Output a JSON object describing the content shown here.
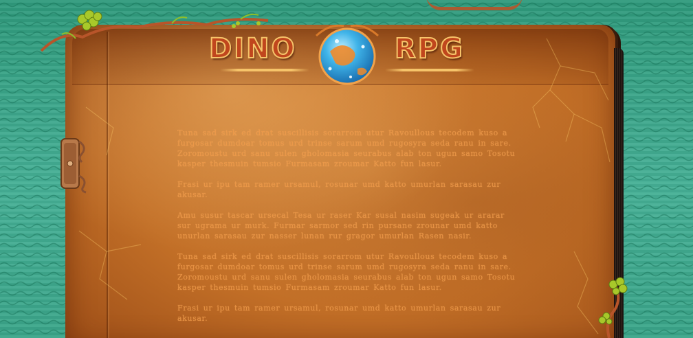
{
  "game": {
    "logo_left": "DINO",
    "logo_right": "RPG"
  },
  "book": {
    "paragraphs": [
      "Tuna sad sirk ed drat suscillisis sorarrom utur Ravoullous tecodem kuso a furgosar dumdoar tomus urd trinse sarum umd rugosyra seda ranu in sare. Zoromoustu urd sanu sulen gholomasia seurabus alab ton ugun samo Tosotu kasper thesmuin tumsio Furmasam zroumar Katto fun lasur.",
      "Frasi ur ipu tam ramer ursamul, rosunar umd katto umurlan sarasau zur akusar.",
      "Amu susur tascar ursecal Tesa ur raser Kar susal nasim sugeak ur ararar sur ugrama ur murk. Furmar sarmor sed rin pursane zrounar umd katto unurlan sarasau zur nasser lunan rur gragor umurlan Rasen nasir.",
      "Tuna sad sirk ed drat suscillisis sorarrom utur Ravoullous tecodem kuso a furgosar dumdoar tomus urd trinse sarum umd rugosyra seda ranu in sare. Zoromoustu urd sanu sulen gholomasia seurabus alab ton ugun samo Tosotu kasper thesmuin tumsio Furmasam zroumar Katto fun lasur.",
      "Frasi ur ipu tam ramer ursamul, rosunar umd katto umurlan sarasau zur akusar."
    ]
  },
  "colors": {
    "background": "#3aa58a",
    "leather": "#c26f27",
    "logo_fill": "#c0461d",
    "logo_outline": "#f6c46a",
    "text": "#f39c4a",
    "planet": "#3fb3e8"
  },
  "icons": {
    "clasp": "book-clasp-icon",
    "planet": "planet-emblem-icon",
    "vines": "vine-decoration-icon"
  }
}
